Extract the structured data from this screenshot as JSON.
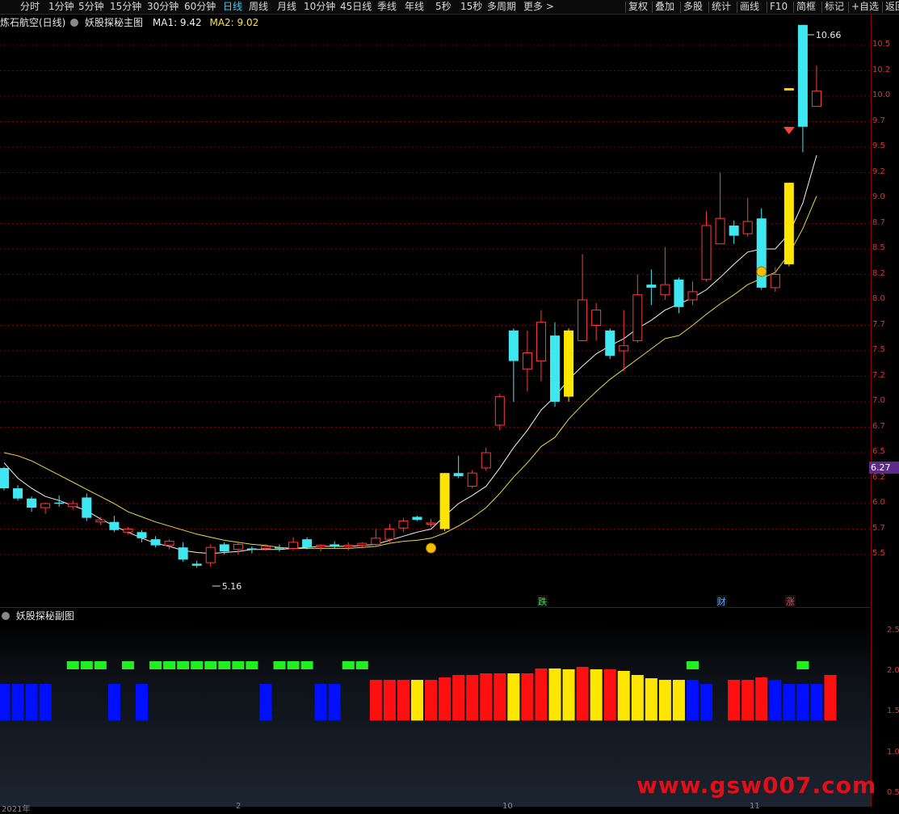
{
  "toolbar": {
    "periods": [
      "分时",
      "1分钟",
      "5分钟",
      "15分钟",
      "30分钟",
      "60分钟",
      "日线",
      "周线",
      "月线",
      "10分钟",
      "45日线",
      "季线",
      "年线",
      "5秒",
      "15秒",
      "多周期",
      "更多 >"
    ],
    "active_period": "日线",
    "actions": [
      "复权",
      "叠加",
      "多股",
      "统计",
      "画线",
      "F10",
      "简框",
      "标记",
      "+自选",
      "返回"
    ]
  },
  "main_panel": {
    "stock": "炼石航空(日线)",
    "indicator": "妖股探秘主图",
    "ma1_text": "MA1: 9.42",
    "ma2_text": "MA2: 9.02",
    "price_labels": [
      "10.5",
      "10.2",
      "10.0",
      "9.7",
      "9.5",
      "9.2",
      "9.0",
      "8.7",
      "8.5",
      "8.2",
      "8.0",
      "7.7",
      "7.5",
      "7.2",
      "7.0",
      "6.7",
      "6.5",
      "6.2",
      "6.0",
      "5.7",
      "5.5"
    ],
    "current_price": "6.27",
    "high_label": "10.66",
    "low_label": "5.16",
    "signals": [
      {
        "text": "跌",
        "color": "#2ee04a"
      },
      {
        "text": "财",
        "color": "#5aa8ff"
      },
      {
        "text": "涨",
        "color": "#ff4040"
      }
    ]
  },
  "sub_panel": {
    "indicator": "妖股探秘副图",
    "labels": [
      "2.5",
      "2.0",
      "1.5",
      "1.0",
      "0.5"
    ]
  },
  "bottom_axis": [
    "2021年",
    "2",
    "10",
    "11"
  ],
  "watermark": "www.gsw007.com",
  "colors": {
    "up": "#ff3b3b",
    "down": "#3fe8f0",
    "yellow": "#ffe600",
    "blue": "#0010ff",
    "green": "#22ee22",
    "red": "#ff1010"
  },
  "chart_data": {
    "type": "candlestick",
    "candles": [
      [
        6.35,
        6.15,
        6.36,
        6.13,
        "d"
      ],
      [
        6.15,
        6.05,
        6.18,
        6.03,
        "d"
      ],
      [
        6.05,
        5.96,
        6.07,
        5.92,
        "d"
      ],
      [
        5.96,
        6.0,
        6.01,
        5.9,
        "u"
      ],
      [
        6.01,
        6.0,
        6.08,
        5.97,
        "d"
      ],
      [
        6.0,
        5.97,
        6.03,
        5.94,
        "u"
      ],
      [
        6.06,
        5.86,
        6.1,
        5.83,
        "d"
      ],
      [
        5.82,
        5.84,
        5.87,
        5.79,
        "u"
      ],
      [
        5.82,
        5.74,
        5.88,
        5.72,
        "d"
      ],
      [
        5.72,
        5.75,
        5.77,
        5.7,
        "u"
      ],
      [
        5.72,
        5.66,
        5.74,
        5.62,
        "d"
      ],
      [
        5.65,
        5.59,
        5.68,
        5.57,
        "d"
      ],
      [
        5.59,
        5.63,
        5.65,
        5.55,
        "u"
      ],
      [
        5.57,
        5.45,
        5.62,
        5.43,
        "d"
      ],
      [
        5.41,
        5.39,
        5.44,
        5.37,
        "d"
      ],
      [
        5.42,
        5.57,
        5.6,
        5.38,
        "u"
      ],
      [
        5.6,
        5.53,
        5.62,
        5.5,
        "d"
      ],
      [
        5.55,
        5.6,
        5.62,
        5.5,
        "u"
      ],
      [
        5.56,
        5.56,
        5.58,
        5.51,
        "d"
      ],
      [
        5.56,
        5.58,
        5.6,
        5.54,
        "u"
      ],
      [
        5.57,
        5.57,
        5.6,
        5.53,
        "d"
      ],
      [
        5.56,
        5.62,
        5.67,
        5.54,
        "u"
      ],
      [
        5.65,
        5.57,
        5.67,
        5.55,
        "d"
      ],
      [
        5.58,
        5.59,
        5.6,
        5.53,
        "u"
      ],
      [
        5.6,
        5.58,
        5.63,
        5.56,
        "d"
      ],
      [
        5.59,
        5.59,
        5.62,
        5.54,
        "u"
      ],
      [
        5.59,
        5.61,
        5.62,
        5.57,
        "u"
      ],
      [
        5.6,
        5.66,
        5.75,
        5.58,
        "u"
      ],
      [
        5.65,
        5.75,
        5.8,
        5.62,
        "u"
      ],
      [
        5.76,
        5.83,
        5.86,
        5.72,
        "u"
      ],
      [
        5.87,
        5.84,
        5.88,
        5.83,
        "d"
      ],
      [
        5.81,
        5.81,
        5.85,
        5.77,
        "u"
      ],
      [
        5.75,
        6.3,
        6.3,
        5.73,
        "y"
      ],
      [
        6.3,
        6.27,
        6.47,
        6.25,
        "d"
      ],
      [
        6.17,
        6.3,
        6.33,
        6.15,
        "u"
      ],
      [
        6.35,
        6.5,
        6.55,
        6.32,
        "u"
      ],
      [
        6.77,
        7.05,
        7.08,
        6.72,
        "u"
      ],
      [
        7.7,
        7.4,
        7.72,
        7.0,
        "d"
      ],
      [
        7.32,
        7.48,
        7.7,
        7.1,
        "u"
      ],
      [
        7.4,
        7.78,
        7.9,
        7.2,
        "u"
      ],
      [
        7.65,
        7.0,
        7.78,
        6.95,
        "d"
      ],
      [
        7.05,
        7.7,
        7.72,
        7.0,
        "y"
      ],
      [
        7.6,
        8.0,
        8.45,
        7.6,
        "u"
      ],
      [
        7.75,
        7.9,
        7.97,
        7.6,
        "u"
      ],
      [
        7.7,
        7.45,
        7.72,
        7.42,
        "d"
      ],
      [
        7.5,
        7.55,
        7.9,
        7.3,
        "u"
      ],
      [
        7.6,
        8.05,
        8.25,
        7.58,
        "u"
      ],
      [
        8.15,
        8.12,
        8.3,
        7.95,
        "d"
      ],
      [
        8.05,
        8.15,
        8.52,
        8.0,
        "u"
      ],
      [
        8.2,
        7.93,
        8.22,
        7.87,
        "d"
      ],
      [
        8.0,
        8.08,
        8.18,
        7.95,
        "u"
      ],
      [
        8.2,
        8.73,
        8.87,
        8.18,
        "u"
      ],
      [
        8.55,
        8.8,
        9.25,
        8.55,
        "u"
      ],
      [
        8.73,
        8.63,
        8.78,
        8.55,
        "d"
      ],
      [
        8.65,
        8.77,
        9.0,
        8.62,
        "u"
      ],
      [
        8.8,
        8.12,
        8.9,
        8.1,
        "d"
      ],
      [
        8.12,
        8.25,
        8.32,
        8.08,
        "u"
      ],
      [
        8.35,
        9.15,
        9.15,
        8.33,
        "y"
      ],
      [
        9.7,
        10.7,
        10.7,
        9.45,
        "d"
      ],
      [
        9.9,
        10.05,
        10.3,
        9.9,
        "u"
      ]
    ],
    "ma1": [
      6.4,
      6.25,
      6.15,
      6.07,
      6.03,
      5.98,
      5.93,
      5.85,
      5.78,
      5.72,
      5.66,
      5.61,
      5.58,
      5.54,
      5.52,
      5.51,
      5.52,
      5.53,
      5.55,
      5.55,
      5.55,
      5.56,
      5.57,
      5.58,
      5.58,
      5.58,
      5.59,
      5.6,
      5.64,
      5.68,
      5.72,
      5.75,
      5.88,
      6.0,
      6.08,
      6.17,
      6.35,
      6.55,
      6.72,
      6.92,
      7.05,
      7.22,
      7.35,
      7.47,
      7.55,
      7.62,
      7.72,
      7.8,
      7.9,
      7.96,
      8.02,
      8.1,
      8.22,
      8.35,
      8.47,
      8.5,
      8.5,
      8.65,
      8.95,
      9.42
    ],
    "ma2": [
      6.5,
      6.47,
      6.42,
      6.35,
      6.28,
      6.21,
      6.14,
      6.07,
      6.0,
      5.92,
      5.87,
      5.82,
      5.78,
      5.74,
      5.7,
      5.67,
      5.64,
      5.62,
      5.6,
      5.59,
      5.57,
      5.56,
      5.56,
      5.56,
      5.56,
      5.56,
      5.57,
      5.58,
      5.61,
      5.63,
      5.64,
      5.66,
      5.71,
      5.78,
      5.86,
      5.96,
      6.1,
      6.26,
      6.4,
      6.56,
      6.65,
      6.83,
      6.97,
      7.1,
      7.22,
      7.32,
      7.42,
      7.52,
      7.62,
      7.65,
      7.75,
      7.86,
      7.96,
      8.05,
      8.15,
      8.21,
      8.27,
      8.45,
      8.7,
      9.02
    ],
    "sub_bars": [
      [
        "b",
        1.85
      ],
      [
        "b",
        1.85
      ],
      [
        "b",
        1.85
      ],
      [
        "b",
        1.85
      ],
      [
        "n",
        0
      ],
      [
        "n",
        0
      ],
      [
        "n",
        0
      ],
      [
        "n",
        0
      ],
      [
        "b",
        1.85
      ],
      [
        "n",
        0
      ],
      [
        "b",
        1.85
      ],
      [
        "n",
        0
      ],
      [
        "n",
        0
      ],
      [
        "n",
        0
      ],
      [
        "n",
        0
      ],
      [
        "n",
        0
      ],
      [
        "n",
        0
      ],
      [
        "n",
        0
      ],
      [
        "n",
        0
      ],
      [
        "b",
        1.85
      ],
      [
        "n",
        0
      ],
      [
        "n",
        0
      ],
      [
        "n",
        0
      ],
      [
        "b",
        1.85
      ],
      [
        "b",
        1.85
      ],
      [
        "n",
        0
      ],
      [
        "n",
        0
      ],
      [
        "r",
        1.9
      ],
      [
        "r",
        1.9
      ],
      [
        "r",
        1.9
      ],
      [
        "y",
        1.9
      ],
      [
        "r",
        1.9
      ],
      [
        "r",
        1.93
      ],
      [
        "r",
        1.96
      ],
      [
        "r",
        1.96
      ],
      [
        "r",
        1.98
      ],
      [
        "r",
        1.98
      ],
      [
        "y",
        1.98
      ],
      [
        "r",
        1.98
      ],
      [
        "r",
        2.04
      ],
      [
        "y",
        2.04
      ],
      [
        "y",
        2.03
      ],
      [
        "r",
        2.06
      ],
      [
        "y",
        2.03
      ],
      [
        "r",
        2.03
      ],
      [
        "y",
        2.01
      ],
      [
        "y",
        1.96
      ],
      [
        "y",
        1.92
      ],
      [
        "y",
        1.9
      ],
      [
        "y",
        1.9
      ],
      [
        "b",
        1.9
      ],
      [
        "b",
        1.85
      ],
      [
        "n",
        0
      ],
      [
        "r",
        1.9
      ],
      [
        "r",
        1.9
      ],
      [
        "r",
        1.93
      ],
      [
        "b",
        1.9
      ],
      [
        "b",
        1.85
      ],
      [
        "b",
        1.85
      ],
      [
        "b",
        1.85
      ],
      [
        "r",
        1.96
      ]
    ],
    "green_marks": [
      5,
      6,
      7,
      9,
      11,
      12,
      13,
      14,
      15,
      16,
      17,
      18,
      20,
      21,
      22,
      25,
      26,
      50,
      58
    ],
    "y_range": [
      5.16,
      10.66
    ]
  }
}
